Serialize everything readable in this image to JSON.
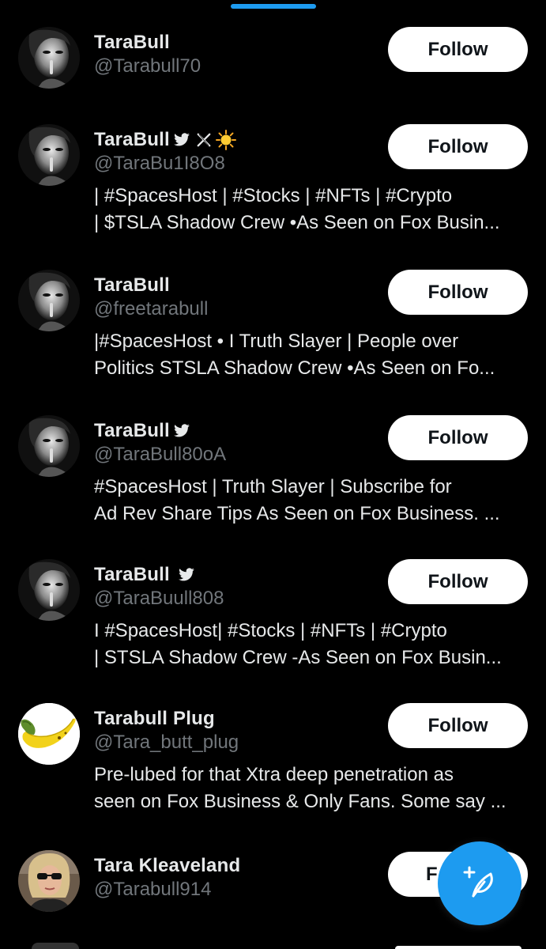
{
  "follow_label": "Follow",
  "colors": {
    "accent": "#1d9bf0",
    "background": "#000000",
    "secondary_text": "#71767b"
  },
  "accounts": [
    {
      "name": "TaraBull",
      "handle": "@Tarabull70",
      "bio": [],
      "badges": [],
      "avatar": "bw-portrait"
    },
    {
      "name": "TaraBull",
      "handle": "@TaraBu1I8O8",
      "bio": [
        "| #SpacesHost | #Stocks | #NFTs | #Crypto",
        "| $TSLA Shadow Crew •As Seen on Fox Busin..."
      ],
      "badges": [
        "bird-icon",
        "x-logo-icon",
        "sun-icon"
      ],
      "avatar": "bw-portrait"
    },
    {
      "name": "TaraBull",
      "handle": "@freetarabull",
      "bio": [
        "|#SpacesHost • I Truth Slayer | People over",
        "Politics STSLA Shadow Crew •As Seen on Fo..."
      ],
      "badges": [],
      "avatar": "bw-portrait"
    },
    {
      "name": "TaraBull",
      "handle": "@TaraBull80oA",
      "bio": [
        "#SpacesHost | Truth Slayer | Subscribe for",
        "Ad  Rev Share Tips As Seen on Fox Business. ..."
      ],
      "badges": [
        "bird-icon"
      ],
      "avatar": "bw-portrait"
    },
    {
      "name": "TaraBull",
      "handle": "@TaraBuull808",
      "bio": [
        "I #SpacesHost| #Stocks | #NFTs | #Crypto",
        "| STSLA Shadow Crew -As Seen on Fox Busin..."
      ],
      "badges": [
        "bird-icon"
      ],
      "avatar": "bw-portrait"
    },
    {
      "name": "Tarabull Plug",
      "handle": "@Tara_butt_plug",
      "bio": [
        "Pre-lubed for that Xtra deep penetration as",
        "seen on Fox Business & Only Fans. Some say ..."
      ],
      "badges": [],
      "avatar": "banana"
    },
    {
      "name": "Tara Kleaveland",
      "handle": "@Tarabull914",
      "bio": [],
      "badges": [],
      "avatar": "color-portrait",
      "follow_partial": "F"
    }
  ],
  "compose_button": {
    "icon": "compose-feather-icon"
  }
}
